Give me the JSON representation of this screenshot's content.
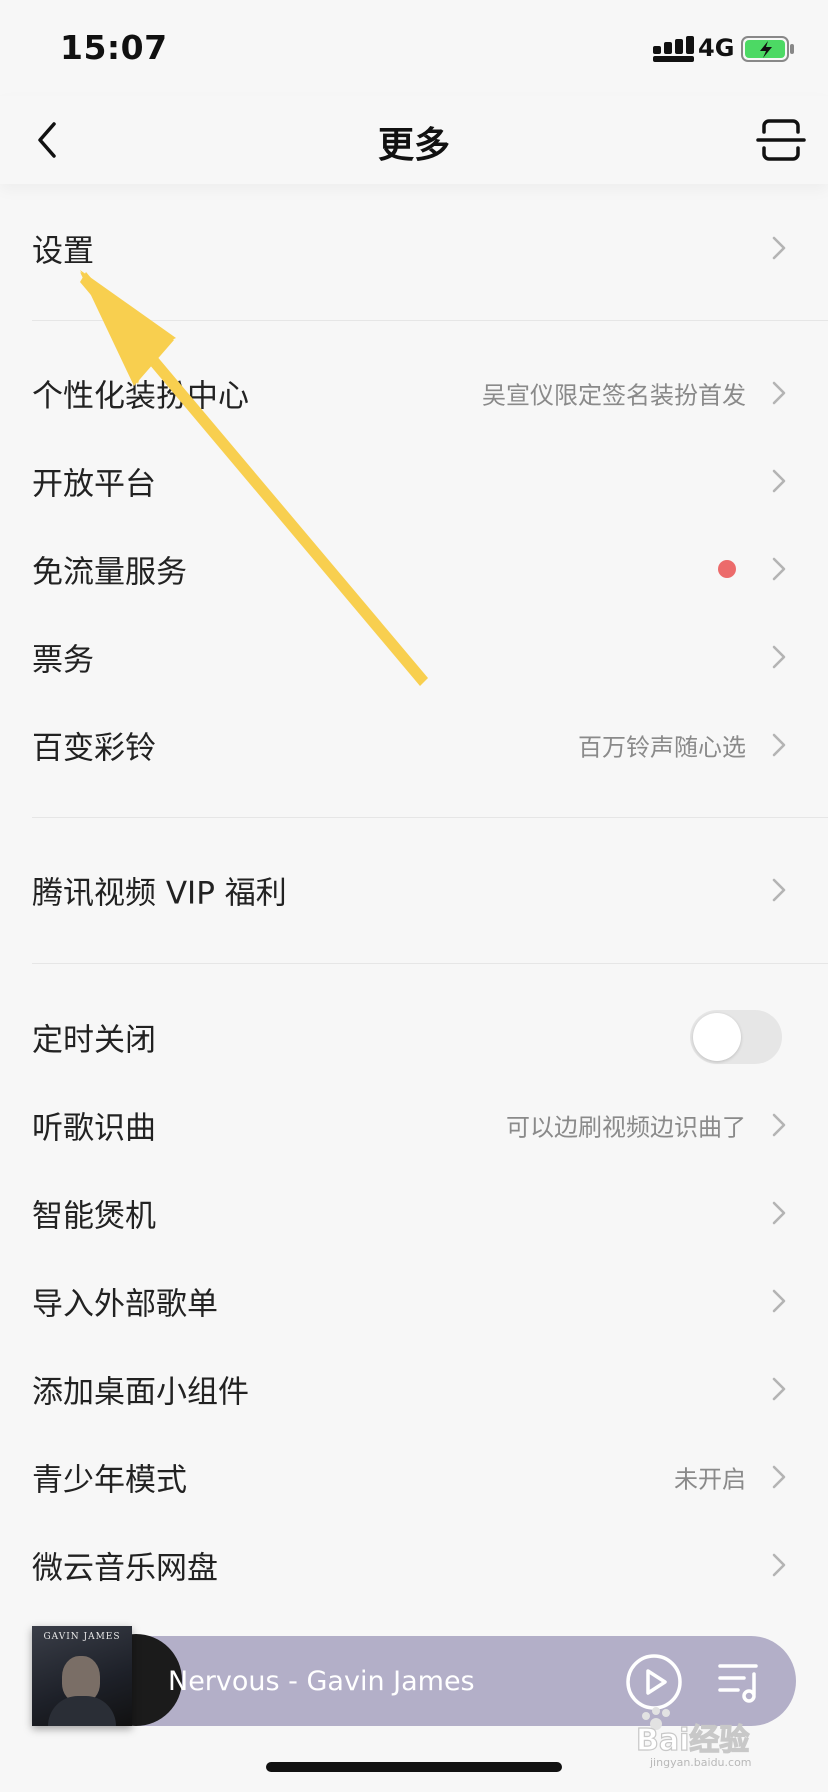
{
  "status_bar": {
    "time": "15:07",
    "network": "4G"
  },
  "header": {
    "title": "更多"
  },
  "menu": {
    "settings": {
      "label": "设置"
    },
    "personalization": {
      "label": "个性化装扮中心",
      "subtitle": "吴宣仪限定签名装扮首发"
    },
    "open_platform": {
      "label": "开放平台"
    },
    "free_data": {
      "label": "免流量服务"
    },
    "tickets": {
      "label": "票务"
    },
    "ringtones": {
      "label": "百变彩铃",
      "subtitle": "百万铃声随心选"
    },
    "tencent_video": {
      "label": "腾讯视频 VIP 福利"
    },
    "timer": {
      "label": "定时关闭",
      "enabled": false
    },
    "recognize": {
      "label": "听歌识曲",
      "subtitle": "可以边刷视频边识曲了"
    },
    "smart_cook": {
      "label": "智能煲机"
    },
    "import_playlist": {
      "label": "导入外部歌单"
    },
    "widget": {
      "label": "添加桌面小组件"
    },
    "youth_mode": {
      "label": "青少年模式",
      "subtitle": "未开启"
    },
    "weiyun": {
      "label": "微云音乐网盘"
    }
  },
  "player": {
    "song": "Nervous - Gavin James",
    "album_text": "GAVIN JAMES"
  },
  "watermark": {
    "text": "Bai经验",
    "sub": "jingyan.baidu.com"
  },
  "colors": {
    "accent_arrow": "#f8cf4f",
    "badge_red": "#ec6b6b",
    "player_bg": "#b3afc8"
  }
}
